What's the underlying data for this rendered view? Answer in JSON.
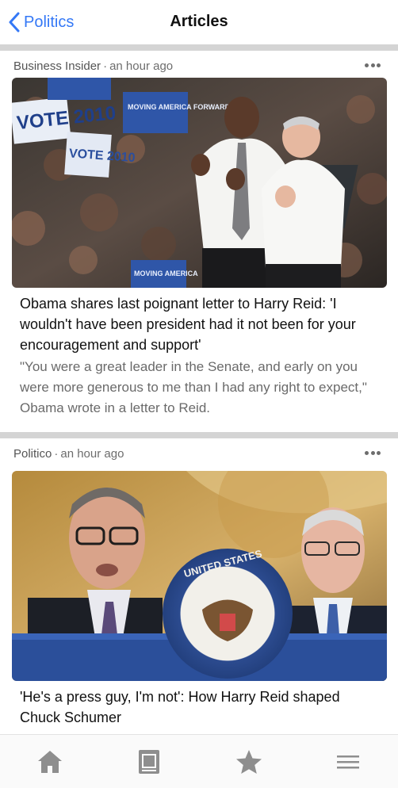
{
  "navbar": {
    "back_label": "Politics",
    "title": "Articles"
  },
  "articles": [
    {
      "source": "Business Insider",
      "time": "an hour ago",
      "headline": "Obama shares last poignant letter to Harry Reid: 'I wouldn't have been president had it not been for your encouragement and support'",
      "summary": "\"You were a great leader in the Senate, and early on you were more generous to me than I had any right to expect,\" Obama wrote in a letter to Reid.",
      "image_signs": [
        "VOTE 2010",
        "MOVING AMERICA FORWARD",
        "VOTE 2010",
        "MOVING AMERICA"
      ]
    },
    {
      "source": "Politico",
      "time": "an hour ago",
      "headline": "'He's a press guy, I'm not': How Harry Reid shaped Chuck Schumer",
      "summary": "",
      "image_signs": [
        "UNITED STATES"
      ]
    }
  ],
  "tabbar": {
    "tabs": [
      "home-icon",
      "newspaper-icon",
      "star-icon",
      "menu-icon"
    ]
  },
  "colors": {
    "accent": "#3478f6",
    "separator": "#d4d4d4",
    "tab_icon": "#8e8e8e"
  }
}
